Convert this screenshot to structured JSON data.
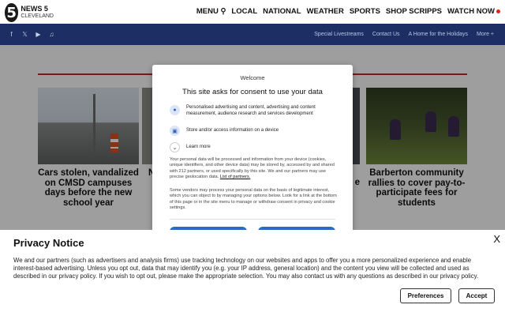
{
  "header": {
    "logo_number": "5",
    "logo_line1": "NEWS 5",
    "logo_line2": "CLEVELAND",
    "nav": [
      "MENU",
      "LOCAL",
      "NATIONAL",
      "WEATHER",
      "SPORTS",
      "SHOP SCRIPPS",
      "WATCH NOW"
    ],
    "menu_icon": "search-icon"
  },
  "subnav": {
    "social_icons": [
      "facebook-icon",
      "x-icon",
      "youtube-icon",
      "tiktok-icon"
    ],
    "links": [
      "Special Livestreams",
      "Contact Us",
      "A Home for the Holidays",
      "More +"
    ]
  },
  "cards": [
    {
      "headline": "Cars stolen, vandalized on CMSD campuses days before the new school year"
    },
    {
      "headline": "N"
    },
    {
      "headline": "e"
    },
    {
      "headline": "Barberton community rallies to cover pay-to-participate fees for students"
    }
  ],
  "consent": {
    "welcome": "Welcome",
    "title": "This site asks for consent to use your data",
    "purposes": [
      {
        "icon": "person-icon",
        "text": "Personalised advertising and content, advertising and content measurement, audience research and services development"
      },
      {
        "icon": "device-icon",
        "text": "Store and/or access information on a device"
      },
      {
        "icon": "chevron-down-icon",
        "text": "Learn more"
      }
    ],
    "para1": "Your personal data will be processed and information from your device (cookies, unique identifiers, and other device data) may be stored by, accessed by and shared with 212 partners, or used specifically by this site. We and our partners may use precise geolocation data.",
    "para1_link": "List of partners.",
    "para2": "Some vendors may process your personal data on the basis of legitimate interest, which you can object to by managing your options below. Look for a link at the bottom of this page or in the site menu to manage or withdraw consent in privacy and cookie settings."
  },
  "privacy": {
    "title": "Privacy Notice",
    "close": "X",
    "body": "We and our partners (such as advertisers and analysis firms) use tracking technology on our websites and apps to offer you a more personalized experience and enable interest-based advertising. Unless you opt out, data that may identify you (e.g. your IP address, general location) and the content you view will be collected and used as described in our privacy policy. If you wish to opt out, please make the appropriate selection. You may also contact us with any questions as described in our privacy policy.",
    "preferences_label": "Preferences",
    "accept_label": "Accept"
  },
  "colors": {
    "nav_bar": "#1c2e63",
    "accent_red": "#c9262c",
    "button_blue": "#2e6ac4"
  }
}
